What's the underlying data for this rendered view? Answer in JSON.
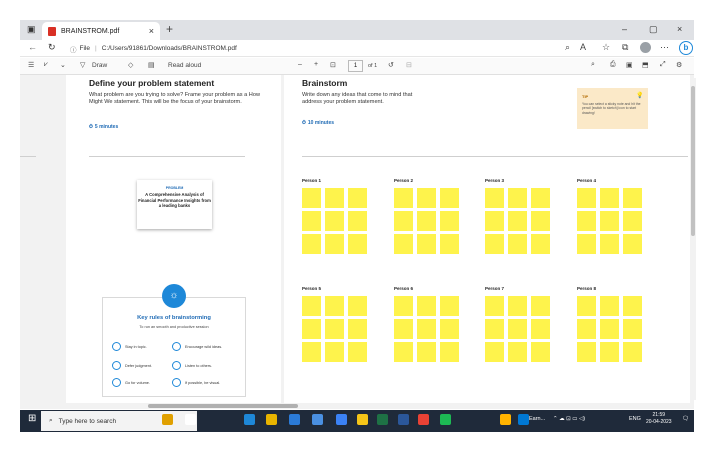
{
  "tab": {
    "title": "BRAINSTROM.pdf",
    "close": "×",
    "new": "+"
  },
  "window": {
    "min": "–",
    "max": "▢",
    "close": "×"
  },
  "address": {
    "label": "File",
    "url": "C:/Users/91861/Downloads/BRAINSTROM.pdf"
  },
  "pdf_toolbar": {
    "draw": "Draw",
    "read_aloud": "Read aloud",
    "minus": "–",
    "plus": "+",
    "page": "1",
    "of": "of 1"
  },
  "left": {
    "title": "Define your problem statement",
    "desc": "What problem are you trying to solve? Frame your problem as a How Might We statement. This will be the focus of your brainstorm.",
    "timer": "5 minutes",
    "card_label": "PROBLEM",
    "card_text": "A Comprehensive Analysis of Financial Performance Insights from a leading banks"
  },
  "rules": {
    "title": "Key rules of brainstorming",
    "subtitle": "To run an smooth and productive session",
    "items": [
      "Stay in topic.",
      "Encourage wild ideas.",
      "Defer judgment.",
      "Listen to others.",
      "Go for volume.",
      "If possible, be visual."
    ]
  },
  "right": {
    "title": "Brainstorm",
    "desc": "Write down any ideas that come to mind that address your problem statement.",
    "timer": "10 minutes"
  },
  "tip": {
    "title": "TIP",
    "text": "You can select a sticky note and hit the pencil [switch to sketch] icon to start drawing!"
  },
  "persons": [
    "Person 1",
    "Person 2",
    "Person 3",
    "Person 4",
    "Person 5",
    "Person 6",
    "Person 7",
    "Person 8"
  ],
  "taskbar": {
    "search": "Type here to search",
    "earn": "Earn...",
    "lang": "ENG",
    "time": "21:59",
    "date": "20-04-2023"
  }
}
